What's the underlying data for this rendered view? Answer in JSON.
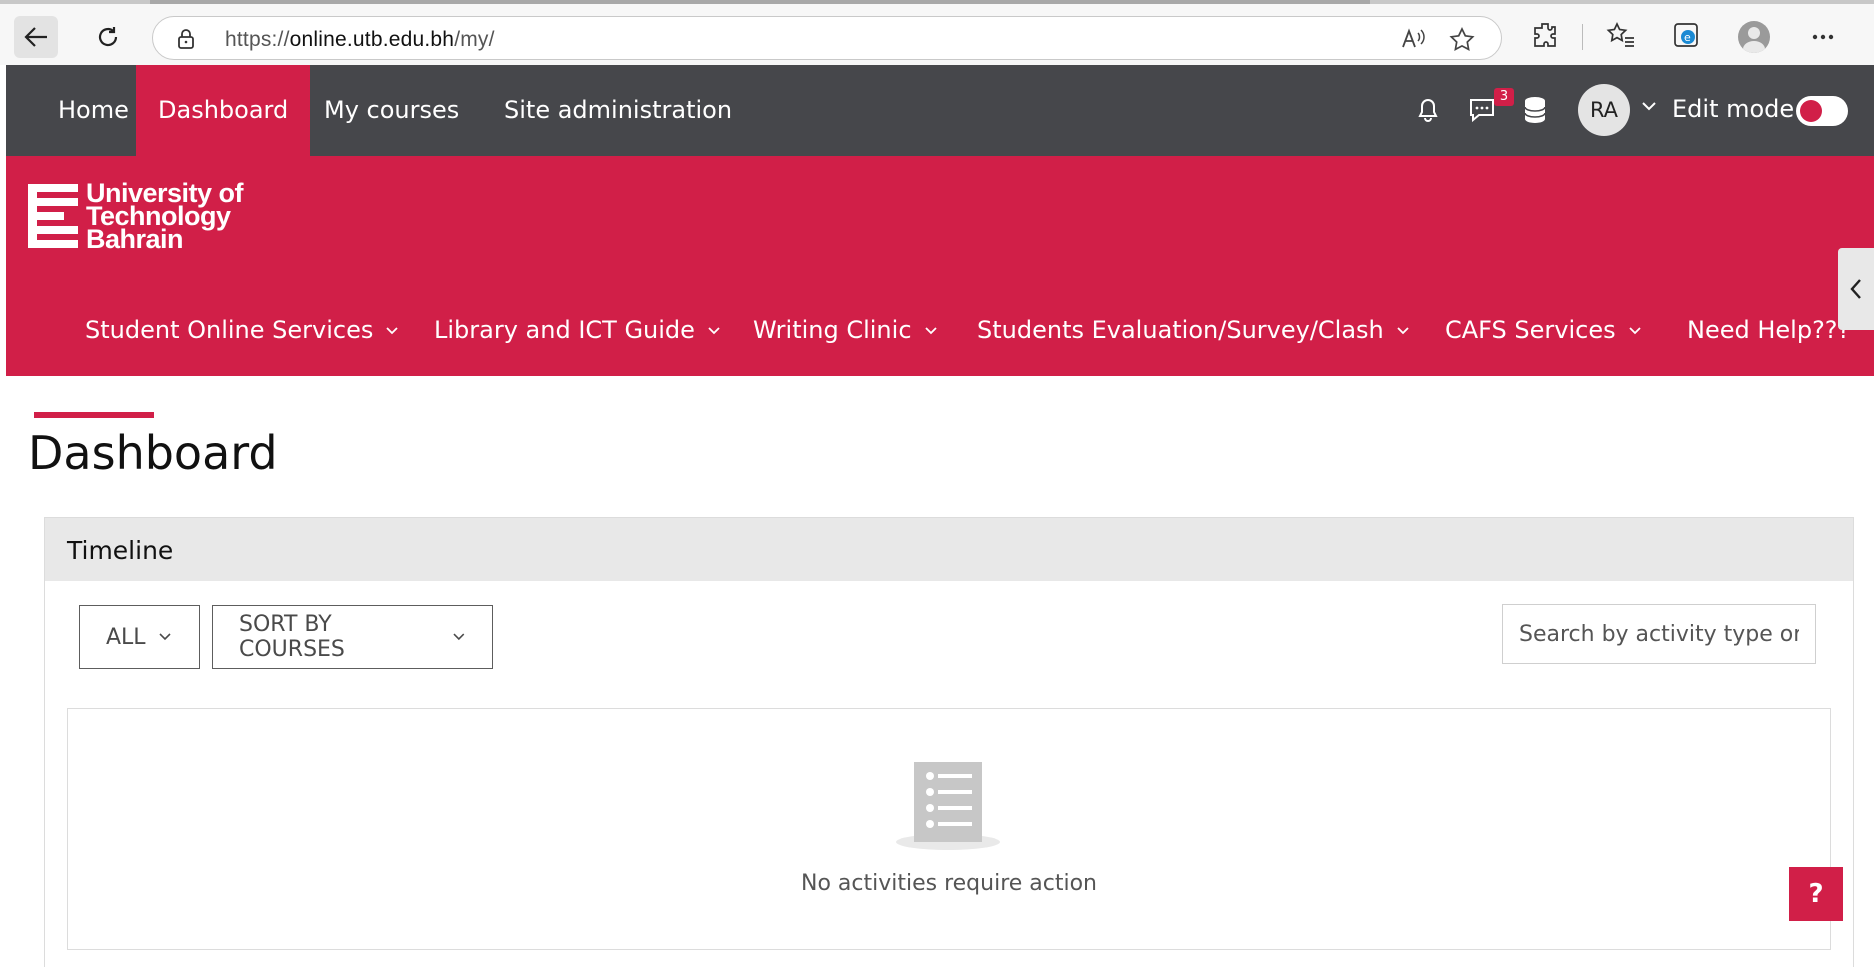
{
  "browser": {
    "url_prefix": "https://",
    "url_host": "online.utb.edu.bh",
    "url_path": "/my/"
  },
  "navbar": {
    "items": [
      {
        "label": "Home"
      },
      {
        "label": "Dashboard",
        "active": true
      },
      {
        "label": "My courses"
      },
      {
        "label": "Site administration"
      }
    ],
    "messages_count": "3",
    "avatar_initials": "RA",
    "edit_mode_label": "Edit mode",
    "edit_mode_on": false
  },
  "header": {
    "logo_lines": [
      "University of",
      "Technology",
      "Bahrain"
    ],
    "menu": [
      {
        "label": "Student Online Services"
      },
      {
        "label": "Library and ICT Guide"
      },
      {
        "label": "Writing Clinic"
      },
      {
        "label": "Students Evaluation/Survey/Clash"
      },
      {
        "label": "CAFS Services"
      },
      {
        "label": "Need Help???"
      }
    ]
  },
  "page": {
    "title": "Dashboard"
  },
  "timeline": {
    "title": "Timeline",
    "filter_label": "ALL",
    "sort_label": "SORT BY COURSES",
    "search_placeholder": "Search by activity type or name",
    "empty_message": "No activities require action"
  },
  "help_button": "?",
  "colors": {
    "brand": "#d11f48",
    "navbar": "#46474b",
    "block_header": "#e8e8e8"
  }
}
